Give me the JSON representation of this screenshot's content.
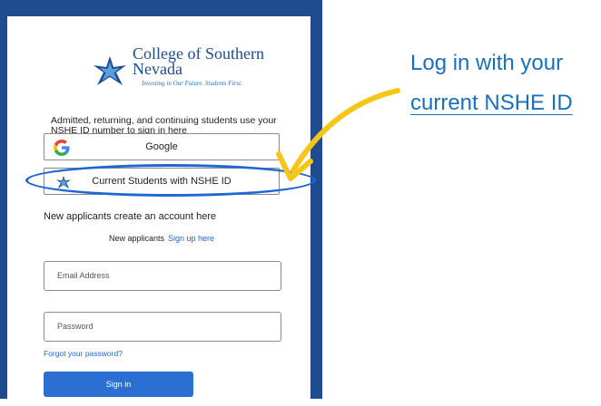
{
  "logo": {
    "name": "College of Southern Nevada",
    "tagline": "Investing in Our Future. Students First."
  },
  "login": {
    "intro": "Admitted, returning, and continuing students use your NSHE ID number to sign in here",
    "providers": [
      {
        "label": "Google",
        "icon": "google-g-icon"
      },
      {
        "label": "Current Students with NSHE ID",
        "icon": "csn-star-icon"
      }
    ],
    "new_applicants_text": "New applicants create an account here",
    "new_applicants_label": "New applicants",
    "signup_link": "Sign up here",
    "email_placeholder": "Email Address",
    "password_placeholder": "Password",
    "forgot_link": "Forgot your password?",
    "signin_label": "Sign in"
  },
  "callout": {
    "line1": "Log in with your",
    "line2": "current NSHE ID"
  },
  "colors": {
    "frame": "#1e4c8f",
    "link": "#1e66d0",
    "button": "#2a6fd1",
    "arrow": "#f5c518",
    "callout_text": "#1a6fbd"
  }
}
